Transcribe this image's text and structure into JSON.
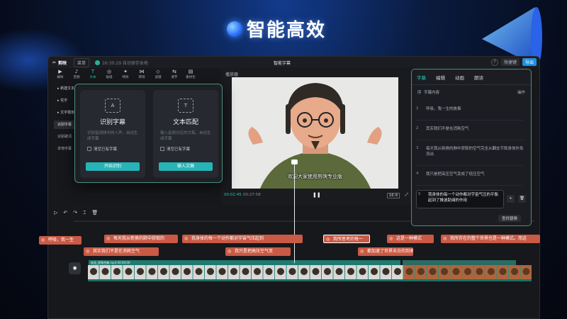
{
  "hero": {
    "title": "智能高效"
  },
  "titlebar": {
    "app_name": "剪映",
    "menu_label": "菜单",
    "save_status": "16:30:29 自动保存本地",
    "doc_title": "智能字幕",
    "shortcut_label": "快捷键",
    "export_label": "导出"
  },
  "toolbar": [
    {
      "icon": "▶",
      "label": "媒体"
    },
    {
      "icon": "♪",
      "label": "音频"
    },
    {
      "icon": "T",
      "label": "文本"
    },
    {
      "icon": "◎",
      "label": "贴纸"
    },
    {
      "icon": "✦",
      "label": "特效"
    },
    {
      "icon": "⋈",
      "label": "转场"
    },
    {
      "icon": "◇",
      "label": "滤镜"
    },
    {
      "icon": "⇆",
      "label": "调节"
    },
    {
      "icon": "▤",
      "label": "素材包"
    }
  ],
  "leftnav": [
    "▸ 新建文本",
    "▸ 花字",
    "▸ 文字模板",
    "识别字幕",
    "识别歌词",
    "本地字幕"
  ],
  "popover": {
    "card1": {
      "icon": "A",
      "title": "识别字幕",
      "desc": "识别音视频中的人声，自动生成字幕",
      "check": "清空已有字幕",
      "button": "开始识别"
    },
    "card2": {
      "icon": "T",
      "title": "文本匹配",
      "desc": "输入音频对应的文稿，自动生成字幕",
      "check": "清空已有字幕",
      "button": "输入文稿"
    }
  },
  "player": {
    "header": "播放器",
    "subtitle": "欢迎大家使用剪映专业版",
    "current_time": "00:02:45",
    "total_time": "00:27:58",
    "ratio": "16:9"
  },
  "rpanel": {
    "tabs": [
      "字幕",
      "编辑",
      "动画",
      "朗读"
    ],
    "col_index": "序",
    "col_content": "字幕内容",
    "col_ops": "操作",
    "rows": [
      {
        "n": "1",
        "text": "呼吸，我一生的故事"
      },
      {
        "n": "2",
        "text": "其实我们不是在消耗空气"
      },
      {
        "n": "3",
        "text": "每天我从新换的肺中获取的空气完全从翻支节和身体外免流出"
      },
      {
        "n": "4",
        "text": "我只是把高压空气变成了低压空气"
      },
      {
        "n": "5",
        "text": "我身体的每一个动作都对宇宙气压的平衡起到了推波助澜的作用"
      }
    ],
    "add_icon": "+",
    "delete_icon": "🗑",
    "find_replace": "查找替换"
  },
  "timeline": {
    "tools": [
      "▷",
      "↶",
      "↷",
      "⌶",
      "🗑"
    ],
    "clip_name": "欢迎_视频合集.mp4  00:00:00",
    "cover_icon": "◉",
    "chips_row1": [
      "呼吸，我一生",
      "每天我从新换的肺中获取的",
      "我身体的每一个动作都对宇宙气压起到",
      "我所思考的每一",
      "这是一种模式",
      "我所存在的整个世界也是一种模式。而这"
    ],
    "chips_row2": [
      "其实我们不是在消耗空气",
      "我只是把高压空气变",
      "都加速了世界末日的到来"
    ]
  }
}
